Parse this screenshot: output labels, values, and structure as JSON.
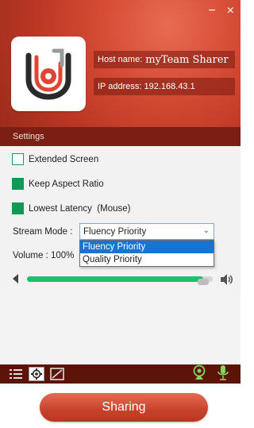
{
  "window": {
    "close_glyph": "×",
    "minimize_glyph": "−"
  },
  "header": {
    "logo_icon": "team-sharer-logo",
    "host_label": "Host name:",
    "host_value": "myTeam Sharer",
    "ip_label": "IP address: 192.168.43.1"
  },
  "settings": {
    "title": "Settings",
    "options": [
      {
        "label": "Extended Screen",
        "checked": false
      },
      {
        "label": "Keep Aspect Ratio",
        "checked": true
      },
      {
        "label": "Lowest Latency  (Mouse)",
        "checked": true
      }
    ],
    "stream_mode_label": "Stream Mode :",
    "stream_mode_value": "Fluency Priority",
    "stream_mode_options": [
      "Fluency Priority",
      "Quality Priority"
    ],
    "volume_label": "Volume : 100%",
    "volume_level": 0.95
  },
  "toolbar": {
    "left_icons": [
      "list-icon",
      "settings-gear-icon",
      "screen-icon"
    ],
    "right_icons": [
      "webcam-icon",
      "microphone-icon"
    ]
  },
  "footer": {
    "share_label": "Sharing"
  },
  "colors": {
    "accent_red": "#c9432c",
    "dark_red": "#7b1f14",
    "green": "#119a55",
    "select_blue": "#1874d0"
  }
}
